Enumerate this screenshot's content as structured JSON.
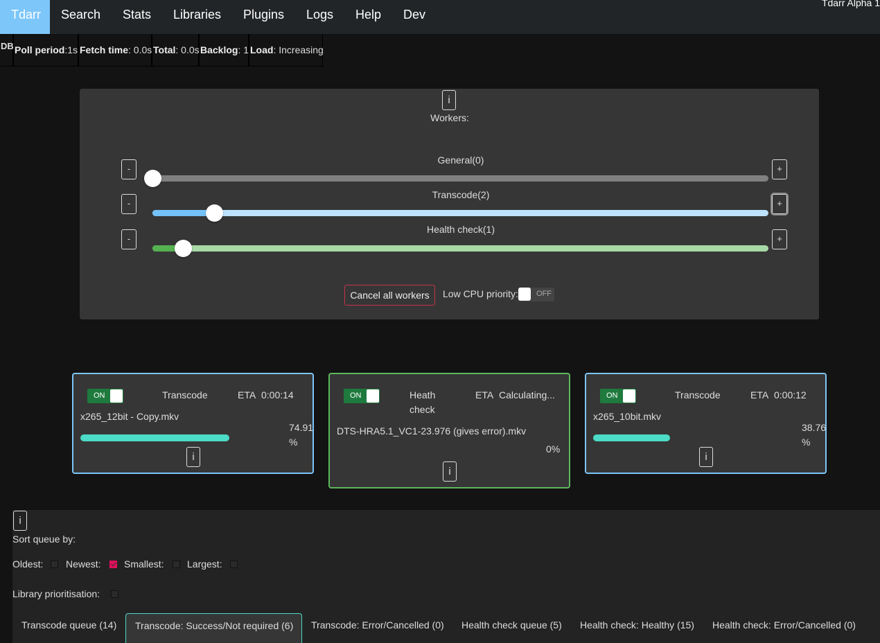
{
  "nav": {
    "items": [
      {
        "label": "Tdarr",
        "active": true
      },
      {
        "label": "Search"
      },
      {
        "label": "Stats"
      },
      {
        "label": "Libraries"
      },
      {
        "label": "Plugins"
      },
      {
        "label": "Logs"
      },
      {
        "label": "Help"
      },
      {
        "label": "Dev"
      }
    ],
    "version": "Tdarr Alpha 1"
  },
  "stats": {
    "db": "DB",
    "poll_period_label": "Poll period",
    "poll_period_value": ":1s",
    "fetch_time_label": "Fetch time",
    "fetch_time_value": ": 0.0s",
    "total_label": "Total",
    "total_value": ": 0.0s",
    "backlog_label": "Backlog",
    "backlog_value": ": 1",
    "load_label": "Load",
    "load_value": ": Increasing"
  },
  "workers": {
    "info_label": "i",
    "title": "Workers:",
    "sliders": [
      {
        "name": "General",
        "label": "General(0)",
        "value": 0,
        "fill_fraction": 0.0,
        "color_fill": "#888888",
        "color_track": "#808080"
      },
      {
        "name": "Transcode",
        "label": "Transcode(2)",
        "value": 2,
        "fill_fraction": 0.1,
        "color_fill": "#73c2fb",
        "color_track": "#bde3fd"
      },
      {
        "name": "Health check",
        "label": "Health check(1)",
        "value": 1,
        "fill_fraction": 0.05,
        "color_fill": "#55b250",
        "color_track": "#a8d8a6"
      }
    ],
    "minus_label": "-",
    "plus_label": "+",
    "cancel_all_label": "Cancel all workers",
    "low_cpu_label": "Low CPU priority:",
    "low_cpu_state": "OFF"
  },
  "worker_cards": [
    {
      "toggle": "ON",
      "type": "Transcode",
      "eta_label": "ETA",
      "eta": "0:00:14",
      "file": "x265_12bit - Copy.mkv",
      "percent_line1": "74.91",
      "percent_line2": "%",
      "progress": 74.91,
      "info": "i",
      "accent": "#7cc6fa"
    },
    {
      "toggle": "ON",
      "type_line1": "Heath",
      "type_line2": "check",
      "eta_label": "ETA",
      "eta": "Calculating...",
      "file": "DTS-HRA5.1_VC1-23.976 (gives error).mkv",
      "percent": "0%",
      "progress": 0,
      "info": "i",
      "accent": "#5cb85c"
    },
    {
      "toggle": "ON",
      "type": "Transcode",
      "eta_label": "ETA",
      "eta": "0:00:12",
      "file": "x265_10bit.mkv",
      "percent_line1": "38.76",
      "percent_line2": "%",
      "progress": 38.76,
      "info": "i",
      "accent": "#7cc6fa"
    }
  ],
  "queue": {
    "info": "i",
    "sort_title": "Sort queue by:",
    "sort_options": [
      {
        "label": "Oldest:",
        "checked": false
      },
      {
        "label": "Newest:",
        "checked": true
      },
      {
        "label": "Smallest:",
        "checked": false
      },
      {
        "label": "Largest:",
        "checked": false
      }
    ],
    "library_prioritisation_label": "Library prioritisation:",
    "library_prioritisation_checked": false,
    "tabs": [
      {
        "label": "Transcode queue (14)",
        "active": false
      },
      {
        "label": "Transcode: Success/Not required (6)",
        "active": true
      },
      {
        "label": "Transcode: Error/Cancelled (0)",
        "active": false
      },
      {
        "label": "Health check queue (5)",
        "active": false
      },
      {
        "label": "Health check: Healthy (15)",
        "active": false
      },
      {
        "label": "Health check: Error/Cancelled (0)",
        "active": false
      }
    ]
  }
}
